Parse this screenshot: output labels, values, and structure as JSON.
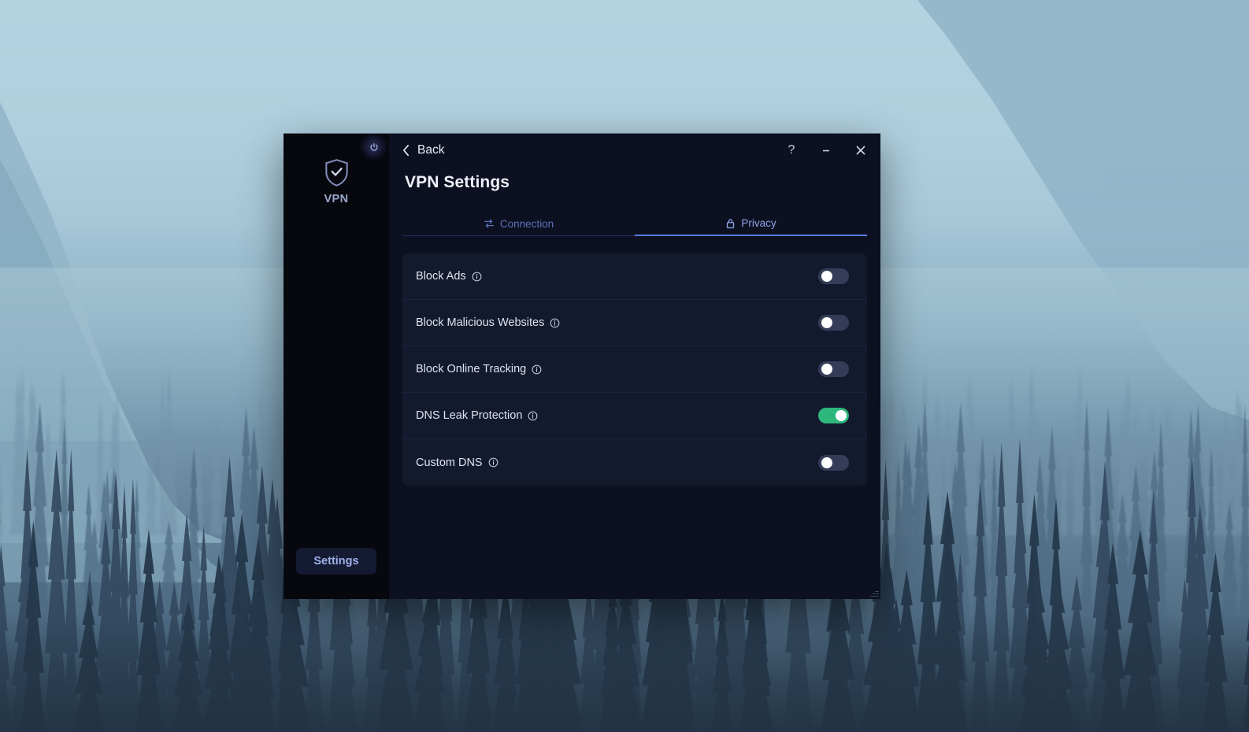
{
  "window": {
    "sidebar": {
      "power_button": "power-icon",
      "brand_icon": "shield-check-icon",
      "brand_label": "VPN",
      "settings_label": "Settings"
    },
    "titlebar": {
      "back_label": "Back",
      "back_icon": "chevron-left-icon",
      "help_label": "?",
      "minimize_label": "minimize-icon",
      "close_label": "close-icon"
    },
    "page_title": "VPN Settings",
    "tabs": [
      {
        "label": "Connection",
        "icon": "transfer-icon",
        "active": false
      },
      {
        "label": "Privacy",
        "icon": "lock-icon",
        "active": true
      }
    ],
    "settings": [
      {
        "label": "Block Ads",
        "info_icon": "info-icon",
        "enabled": false
      },
      {
        "label": "Block Malicious Websites",
        "info_icon": "info-icon",
        "enabled": false
      },
      {
        "label": "Block Online Tracking",
        "info_icon": "info-icon",
        "enabled": false
      },
      {
        "label": "DNS Leak Protection",
        "info_icon": "info-icon",
        "enabled": true
      },
      {
        "label": "Custom DNS",
        "info_icon": "info-icon",
        "enabled": false
      }
    ]
  },
  "colors": {
    "accent_blue": "#5b7ae0",
    "tab_inactive": "#5d72b8",
    "tab_active": "#8fa4e8",
    "toggle_on": "#2eb77c",
    "toggle_off": "#343c58",
    "window_bg": "#0c1020",
    "sidebar_bg": "#07070e",
    "card_bg": "#141a2e"
  }
}
